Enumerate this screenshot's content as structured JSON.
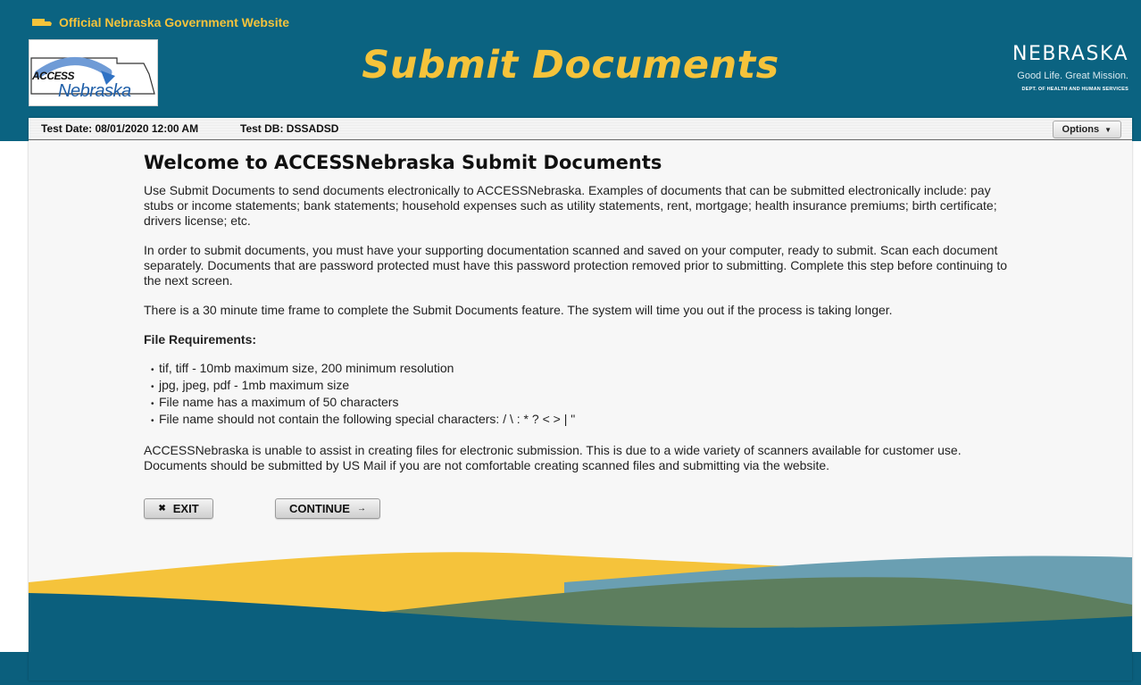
{
  "header": {
    "gov_banner": "Official Nebraska Government Website",
    "logo_access": "ACCESS",
    "logo_nebraska": "Nebraska",
    "title": "Submit Documents",
    "brand_name": "NEBRASKA",
    "brand_tagline": "Good Life. Great Mission.",
    "brand_dept": "DEPT. OF HEALTH AND HUMAN SERVICES"
  },
  "testbar": {
    "test_date": "Test Date: 08/01/2020 12:00 AM",
    "test_db": "Test DB: DSSADSD",
    "options_label": "Options"
  },
  "content": {
    "heading": "Welcome to ACCESSNebraska Submit Documents",
    "para1": "Use Submit Documents to send documents electronically to ACCESSNebraska. Examples of documents that can be submitted electronically include: pay stubs or income statements; bank statements; household expenses such as utility statements, rent, mortgage; health insurance premiums; birth certificate; drivers license; etc.",
    "para2": "In order to submit documents, you must have your supporting documentation scanned and saved on your computer, ready to submit. Scan each document separately. Documents that are password protected must have this password protection removed prior to submitting. Complete this step before continuing to the next screen.",
    "para3": "There is a 30 minute time frame to complete the Submit Documents feature. The system will time you out if the process is taking longer.",
    "requirements_heading": "File Requirements:",
    "requirements": [
      "tif, tiff - 10mb maximum size, 200 minimum resolution",
      "jpg, jpeg, pdf - 1mb maximum size",
      "File name has a maximum of 50 characters",
      "File name should not contain the following special characters: / \\ : * ? < > | \""
    ],
    "para4": "ACCESSNebraska is unable to assist in creating files for electronic submission. This is due to a wide variety of scanners available for customer use. Documents should be submitted by US Mail if you are not comfortable creating scanned files and submitting via the website."
  },
  "buttons": {
    "exit_label": "EXIT",
    "continue_label": "CONTINUE"
  },
  "colors": {
    "header_blue": "#0b6381",
    "gold": "#f5c33b",
    "wave_blue": "#6a9fb2",
    "wave_green": "#5d7e5e"
  }
}
